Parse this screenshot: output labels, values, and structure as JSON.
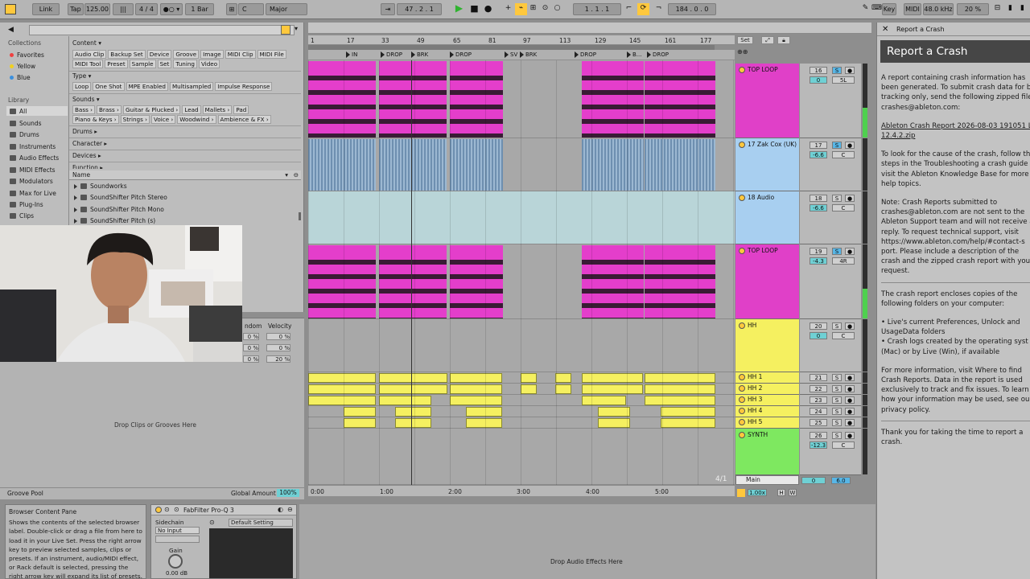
{
  "transport": {
    "link": "Link",
    "tap": "Tap",
    "tempo": "125.00",
    "time_sig": "4 / 4",
    "quantize": "1 Bar",
    "key": "C",
    "scale": "Major",
    "position": "47 . 2 . 1",
    "loop_start": "1 . 1 . 1",
    "loop_length": "184 . 0 . 0",
    "key_label": "Key",
    "midi_label": "MIDI",
    "sample_rate": "48.0 kHz",
    "cpu": "20 %"
  },
  "browser": {
    "collections_heading": "Collections",
    "collections": [
      {
        "label": "Favorites",
        "color": "#ef4040"
      },
      {
        "label": "Yellow",
        "color": "#f0d020"
      },
      {
        "label": "Blue",
        "color": "#3a8fdd"
      }
    ],
    "library_heading": "Library",
    "library": [
      "All",
      "Sounds",
      "Drums",
      "Instruments",
      "Audio Effects",
      "MIDI Effects",
      "Modulators",
      "Max for Live",
      "Plug-Ins",
      "Clips"
    ],
    "content_heading": "Content ▾",
    "content_tags_row1": [
      "Audio Clip",
      "Backup Set",
      "Device",
      "Groove",
      "Image",
      "MIDI Clip",
      "MIDI File"
    ],
    "content_tags_row2": [
      "MIDI Tool",
      "Preset",
      "Sample",
      "Set",
      "Tuning",
      "Video"
    ],
    "type_heading": "Type ▾",
    "type_tags": [
      "Loop",
      "One Shot",
      "MPE Enabled",
      "Multisampled",
      "Impulse Response"
    ],
    "sounds_heading": "Sounds ▾",
    "sounds_row1": [
      "Bass ›",
      "Brass ›",
      "Guitar & Plucked ›",
      "Lead",
      "Mallets ›",
      "Pad"
    ],
    "sounds_row2": [
      "Piano & Keys ›",
      "Strings ›",
      "Voice ›",
      "Woodwind ›",
      "Ambience & FX ›"
    ],
    "drums_heading": "Drums ▸",
    "character_heading": "Character ▸",
    "devices_heading": "Devices ▸",
    "function_heading": "Function ▸",
    "name_col": "Name",
    "files": [
      "Soundworks",
      "SoundShifter Pitch Stereo",
      "SoundShifter Pitch Mono",
      "SoundShifter Pitch (s)"
    ]
  },
  "groove": {
    "random_label": "ndom",
    "velocity_label": "Velocity",
    "random_vals": [
      "0 %",
      "0 %",
      "0 %"
    ],
    "velocity_vals": [
      "0 %",
      "0 %",
      "20 %"
    ],
    "drop_hint": "Drop Clips or Grooves Here",
    "pool_label": "Groove Pool",
    "global_amount_label": "Global Amount",
    "global_amount": "100%"
  },
  "arrangement": {
    "bar_numbers": [
      "1",
      "17",
      "33",
      "49",
      "65",
      "81",
      "97",
      "113",
      "129",
      "145",
      "161",
      "177"
    ],
    "locators": [
      {
        "label": "IN"
      },
      {
        "label": "DROP"
      },
      {
        "label": "BRK"
      },
      {
        "label": "DROP"
      },
      {
        "label": "SV"
      },
      {
        "label": "BRK"
      },
      {
        "label": "DROP"
      },
      {
        "label": "B..."
      },
      {
        "label": "DROP"
      }
    ],
    "time_marks": [
      "0:00",
      "1:00",
      "2:00",
      "3:00",
      "4:00",
      "5:00"
    ],
    "set_label": "Set",
    "time_sig_marker": "4/1",
    "zoom": "1.00x",
    "h_btn": "H",
    "w_btn": "W"
  },
  "tracks": [
    {
      "name": "TOP LOOP",
      "num": "16",
      "vol": "0",
      "pan": "5L",
      "color": "#e040c8"
    },
    {
      "name": "17 Zak Cox (UK)",
      "num": "17",
      "vol": "-6.6",
      "pan": "C",
      "color": "#a8cff0"
    },
    {
      "name": "18 Audio",
      "num": "18",
      "vol": "-6.6",
      "pan": "C",
      "color": "#a8cff0"
    },
    {
      "name": "TOP LOOP",
      "num": "19",
      "vol": "-4.3",
      "pan": "4R",
      "color": "#e040c8"
    },
    {
      "name": "HH",
      "num": "20",
      "vol": "0",
      "pan": "C",
      "color": "#f5f060"
    },
    {
      "name": "HH 1",
      "num": "21",
      "color": "#f5f060"
    },
    {
      "name": "HH 2",
      "num": "22",
      "color": "#f5f060"
    },
    {
      "name": "HH 3",
      "num": "23",
      "color": "#f5f060"
    },
    {
      "name": "HH 4",
      "num": "24",
      "color": "#f5f060"
    },
    {
      "name": "HH 5",
      "num": "25",
      "color": "#f5f060"
    },
    {
      "name": "SYNTH",
      "num": "26",
      "vol": "-12.3",
      "pan": "C",
      "color": "#7ee860"
    }
  ],
  "mixer": {
    "solo": "S",
    "main_label": "Main",
    "main_vol": "0",
    "main_db": "6.0"
  },
  "crash": {
    "tab": "Report a Crash",
    "title": "Report a Crash",
    "p1": [
      "A report containing crash information has",
      "been generated. To submit crash data for b",
      "tracking only, send the following zipped file",
      "crashes@ableton.com:"
    ],
    "filename": [
      "Ableton Crash Report 2026-08-03 191051 L",
      "12.4.2.zip"
    ],
    "p2": [
      "To look for the cause of the crash, follow th",
      "steps in the Troubleshooting a crash guide",
      "visit the Ableton Knowledge Base for more",
      "help topics."
    ],
    "p3": [
      "Note: Crash Reports submitted to",
      "crashes@ableton.com are not sent to the",
      "Ableton Support team and will not receive a",
      "reply. To request technical support, visit",
      "https://www.ableton.com/help/#contact-s",
      "port. Please include a description of the",
      "crash and the zipped crash report with you",
      "request."
    ],
    "p4": [
      "The crash report encloses copies of the",
      "following folders on your computer:"
    ],
    "bullets": [
      "• Live's current Preferences, Unlock and",
      "   UsageData folders",
      "• Crash logs created by the operating syst",
      "   (Mac) or by Live (Win), if available"
    ],
    "p5": [
      "For more information, visit Where to find",
      "Crash Reports. Data in the report is used",
      "exclusively to track and fix issues. To learn",
      "how your information may be used, see our",
      "privacy policy."
    ],
    "p6": [
      "Thank you for taking the time to report a",
      "crash."
    ]
  },
  "info": {
    "title": "Browser Content Pane",
    "lines": [
      "Shows the contents of the selected browser",
      "label. Double-click or drag a file from here to",
      "load it in your Live Set. Press the right arrow",
      "key to preview selected samples, clips or",
      "presets. If an instrument, audio/MIDI effect,",
      "or Rack default is selected, pressing the",
      "right arrow key will expand its list of presets."
    ]
  },
  "device": {
    "name": "FabFilter Pro-Q 3",
    "sidechain_label": "Sidechain",
    "input": "No Input",
    "preset": "Default Setting",
    "gain_label": "Gain",
    "gain_value": "0.00 dB"
  },
  "dropfx": {
    "hint": "Drop Audio Effects Here"
  }
}
